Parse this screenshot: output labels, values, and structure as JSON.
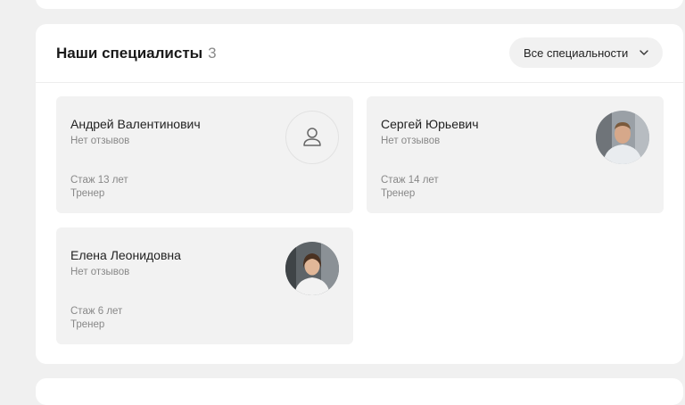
{
  "section": {
    "title": "Наши специалисты",
    "count": "3",
    "filter": {
      "label": "Все специальности",
      "icon": "chevron-down-icon"
    }
  },
  "specialists": [
    {
      "name": "Андрей Валентинович",
      "reviews": "Нет отзывов",
      "experience": "Стаж 13 лет",
      "role": "Тренер",
      "avatar": "user-placeholder-icon"
    },
    {
      "name": "Сергей Юрьевич",
      "reviews": "Нет отзывов",
      "experience": "Стаж 14 лет",
      "role": "Тренер",
      "avatar": "photo"
    },
    {
      "name": "Елена Леонидовна",
      "reviews": "Нет отзывов",
      "experience": "Стаж 6 лет",
      "role": "Тренер",
      "avatar": "photo"
    }
  ]
}
